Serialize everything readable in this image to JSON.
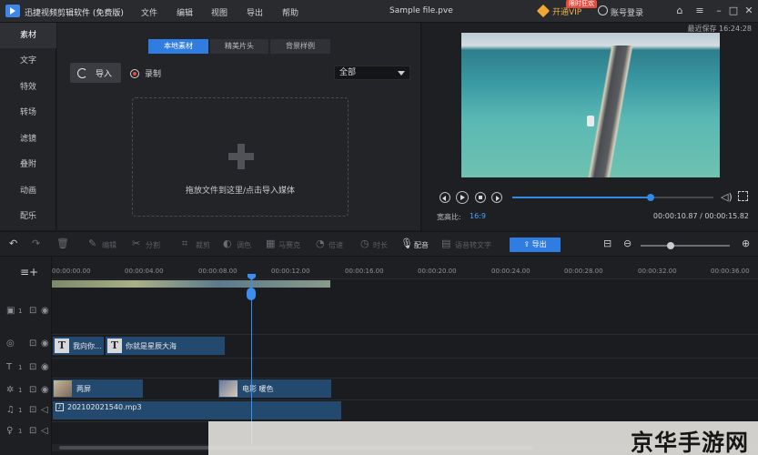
{
  "title_bar": {
    "app_name": "迅捷视频剪辑软件 (免费版)",
    "menus": [
      "文件",
      "编辑",
      "视图",
      "导出",
      "帮助"
    ],
    "file_name": "Sample file.pve",
    "vip_label": "开通VIP",
    "vip_badge": "限时狂欢",
    "login_label": "账号登录",
    "window_icons": [
      "home-icon",
      "menu-icon",
      "minimize-icon",
      "maximize-icon",
      "close-icon"
    ]
  },
  "left_nav": {
    "items": [
      "素材",
      "文字",
      "特效",
      "转场",
      "滤镜",
      "叠附",
      "动画",
      "配乐"
    ],
    "active_index": 0
  },
  "media_panel": {
    "tabs": [
      "本地素材",
      "精美片头",
      "背景样例"
    ],
    "active_tab": 0,
    "import_label": "导入",
    "record_label": "录制",
    "filter_value": "全部",
    "drop_text": "拖放文件到这里/点击导入媒体"
  },
  "preview": {
    "autosave": "最近保存 16:24:28",
    "ratio_label": "宽高比:",
    "ratio_value": "16:9",
    "current_time": "00:00:10.87",
    "total_time": "00:00:15.82",
    "progress": 0.69
  },
  "toolbar": {
    "tools": [
      "编辑",
      "分割",
      "裁剪",
      "调色",
      "马赛克",
      "倍速",
      "时长"
    ],
    "voice_label": "配音",
    "speech_label": "语音转文字",
    "export_label": "导出",
    "zoom_level": 0.34
  },
  "timeline": {
    "ruler_ticks": [
      "00:00:00.00",
      "00:00:04.00",
      "00:00:08.00",
      "00:00:12.00",
      "00:00:16.00",
      "00:00:20.00",
      "00:00:24.00",
      "00:00:28.00",
      "00:00:32.00",
      "00:00:36.00"
    ],
    "text_clips": [
      "我向你...",
      "你就是星辰大海"
    ],
    "overlay_clips": [
      "两屏",
      "电影 暖色"
    ],
    "audio_clip": "202102021540.mp3",
    "track_numbers": [
      "1",
      "1",
      "1",
      "1",
      "1"
    ]
  },
  "watermark": "京华手游网",
  "colors": {
    "accent": "#2f7de1",
    "clip": "#24496e",
    "background": "#1b1c1f"
  }
}
